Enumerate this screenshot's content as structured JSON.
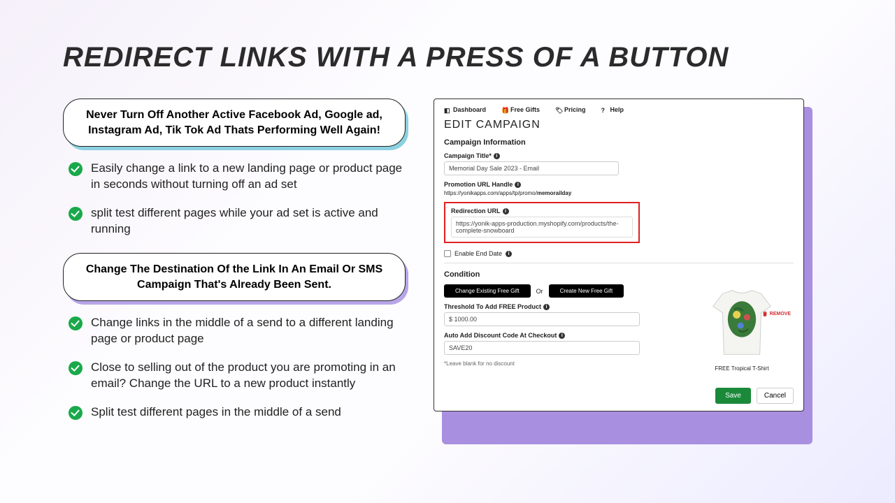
{
  "headline": "REDIRECT LINKS WITH A PRESS OF A BUTTON",
  "callout1": "Never Turn Off Another Active Facebook Ad, Google ad, Instagram Ad, Tik Tok Ad Thats Performing Well Again!",
  "bullets_a": [
    "Easily change a link to a new landing page or product page in seconds without turning off an ad set",
    "split test different pages while your ad set is active and running"
  ],
  "callout2": "Change The Destination Of the Link In An Email Or SMS Campaign That's Already Been Sent.",
  "bullets_b": [
    "Change links in the middle of a send to a different landing page or product page",
    "Close to selling out of the product you are promoting in an email? Change the URL to a new product instantly",
    "Split test different pages in the middle of a send"
  ],
  "panel": {
    "nav": {
      "dashboard": "Dashboard",
      "freeGifts": "Free Gifts",
      "pricing": "Pricing",
      "help": "Help"
    },
    "title": "EDIT CAMPAIGN",
    "section1": "Campaign Information",
    "campaignTitleLabel": "Campaign Title*",
    "campaignTitleValue": "Memorial Day Sale 2023 - Email",
    "promoHandleLabel": "Promotion URL Handle",
    "promoHandlePrefix": "https://yonikapps.com/apps/tp/promo/",
    "promoHandleBold": "memorailday",
    "redirectLabel": "Redirection URL",
    "redirectValue": "https://yonik-apps-production.myshopify.com/products/the-complete-snowboard",
    "enableEndDate": "Enable End Date",
    "section2": "Condition",
    "changeGift": "Change Existing Free Gift",
    "or": "Or",
    "createGift": "Create New Free Gift",
    "thresholdLabel": "Threshold To Add FREE Product",
    "thresholdValue": "$  1000.00",
    "discountLabel": "Auto Add Discount Code At Checkout",
    "discountValue": "SAVE20",
    "discountNote": "*Leave blank for no discount",
    "productCaption": "FREE Tropical T-Shirt",
    "removeLabel": "REMOVE",
    "save": "Save",
    "cancel": "Cancel"
  }
}
